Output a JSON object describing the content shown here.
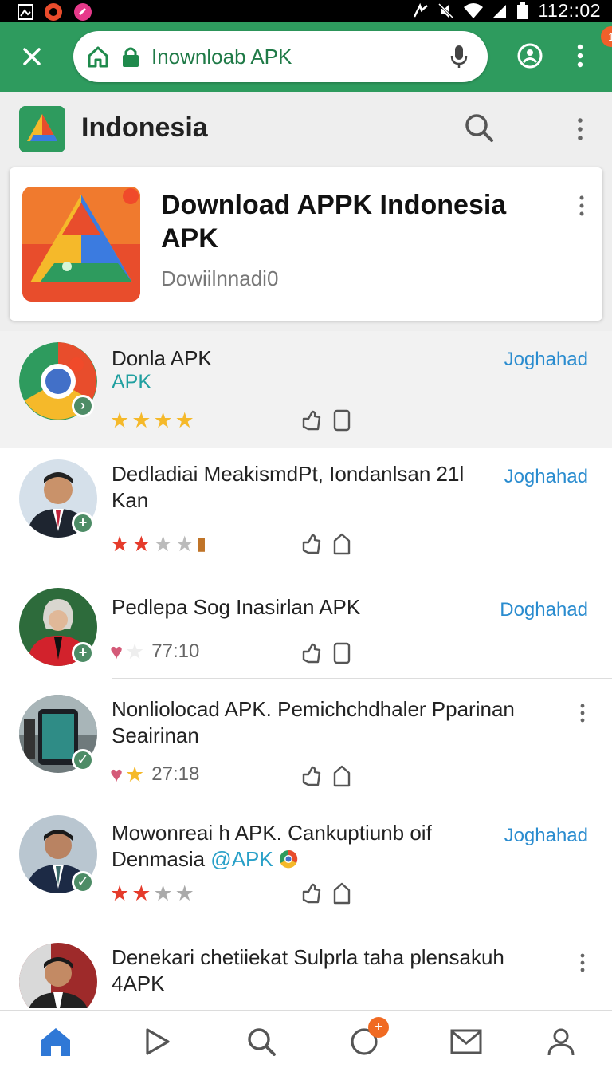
{
  "status_bar": {
    "clock": "112::02",
    "icons": [
      "gallery-icon",
      "app-icon",
      "app-icon-pink",
      "nfc-icon",
      "mute-icon",
      "wifi-icon",
      "signal-icon",
      "battery-icon"
    ]
  },
  "browser": {
    "url": "Inownloab APK",
    "close_icon": "close-icon",
    "account_icon": "account-icon",
    "menu_icon": "overflow-menu-icon",
    "notif_count": "1"
  },
  "site": {
    "title": "Indonesia"
  },
  "featured": {
    "title": "Download APPK Indonesia APK",
    "subtitle": "Dowiilnnadi0"
  },
  "items": [
    {
      "title": "Donla APK",
      "subtitle": "APK",
      "action": "Joghahad",
      "rating": 4,
      "rating_color": "#f5b92a",
      "rating_text": ""
    },
    {
      "title": "Dedladiai MeakismdPt, Iondanlsan 21l Kan",
      "subtitle": "",
      "action": "Joghahad",
      "rating": 2.5,
      "rating_color": "#e53b2b",
      "rating_text": ""
    },
    {
      "title": "Pedlepa Sog Inasirlan APK",
      "subtitle": "",
      "action": "Doghahad",
      "rating_text": "77:10"
    },
    {
      "title": "Nonliolocad APK. Pemichchdhaler Pparinan Seairinan",
      "subtitle": "",
      "action": "",
      "rating_text": "27:18"
    },
    {
      "title": "Mowonreai h APK. Cankuptiunb oif Denmasia",
      "tag": "@APK",
      "action": "Joghahad",
      "rating": 2,
      "rating_color": "#e53b2b",
      "rating_text": ""
    },
    {
      "title": "Denekari chetiiekat Sulprla taha plensakuh 4APK",
      "subtitle": "",
      "action": ""
    }
  ],
  "colors": {
    "brand_green": "#2e9b5e",
    "link_blue": "#2a8ccf",
    "badge_orange": "#f06a22"
  },
  "bottom_nav": [
    "home-icon",
    "play-icon",
    "search-icon",
    "notifications-icon",
    "mail-icon",
    "profile-icon"
  ],
  "bottom_nav_badge": "+"
}
